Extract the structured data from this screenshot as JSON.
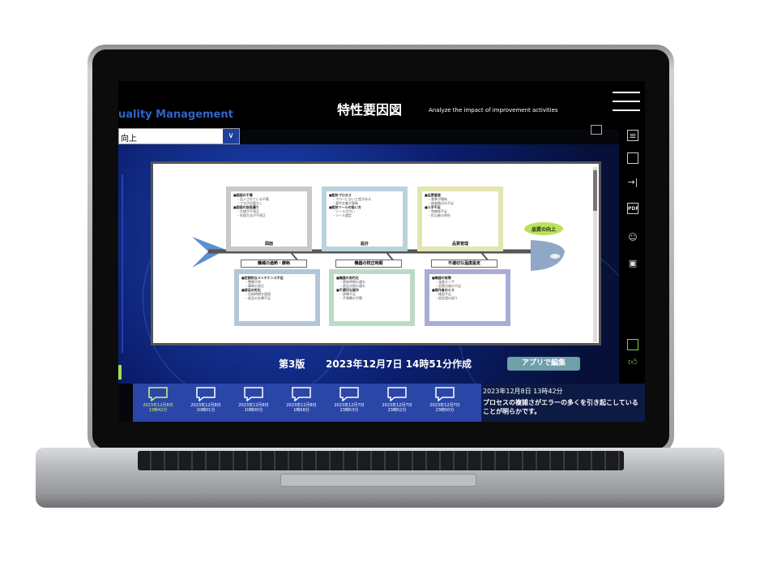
{
  "header": {
    "brand": "uality Management",
    "title": "特性要因図",
    "subtitle": "Analyze the impact of improvement activities"
  },
  "dropdown": {
    "value": "向上",
    "arrow": "∨"
  },
  "diagram": {
    "head_label": "品質の向上",
    "top_boxes": [
      {
        "caption": "図面",
        "color": "#c9c9c9",
        "items": [
          {
            "h": "■図面の不備",
            "s": [
              "・記入されている不備",
              "・寸法が記載なし"
            ]
          },
          {
            "h": "■図面の抜取漏り",
            "s": [
              "・文様が不適正",
              "・処理方法が不適正"
            ]
          }
        ]
      },
      {
        "caption": "設計",
        "color": "#b9d3dd",
        "items": [
          {
            "h": "■設計プロセス",
            "s": [
              "・フローにない工程がある",
              "・要件定義が曖昧"
            ]
          },
          {
            "h": "■設計ツールの扱い方",
            "s": [
              "・ツールが古い",
              "・ツール選定"
            ]
          }
        ]
      },
      {
        "caption": "品質管理",
        "color": "#e3e5b1",
        "items": [
          {
            "h": "■品質管理",
            "s": [
              "・基準が曖昧",
              "・検査観点の不足"
            ]
          },
          {
            "h": "■人手不足",
            "s": [
              "・熟練度不足",
              "・担当者の負担"
            ]
          }
        ]
      }
    ],
    "bottom_boxes": [
      {
        "caption": "機械の過熱・摩耗",
        "color": "#b3c7d9",
        "items": [
          {
            "h": "■定期的なメンテナンス不足",
            "s": [
              "・整備不良",
              "・摩耗の発生"
            ]
          },
          {
            "h": "■部品の劣化",
            "s": [
              "・交換時期を超過",
              "・部品の在庫不足"
            ]
          }
        ]
      },
      {
        "caption": "機器の校正時期",
        "color": "#bddbc4",
        "items": [
          {
            "h": "■機器の老朽化",
            "s": [
              "・更新時期の遅れ",
              "・部品交換の遅れ"
            ]
          },
          {
            "h": "■不適切な操作",
            "s": [
              "・訓練不足",
              "・手順書の不備"
            ]
          }
        ]
      },
      {
        "caption": "不適切な温度設定",
        "color": "#a8add6",
        "items": [
          {
            "h": "■機器の故障",
            "s": [
              "・温度センサ",
              "・定期点検の不足"
            ]
          },
          {
            "h": "■操作者のミス",
            "s": [
              "・確認不足",
              "・設定値の誤り"
            ]
          }
        ]
      }
    ]
  },
  "edition": {
    "version": "第3版",
    "created": "2023年12月7日 14時51分作成",
    "edit_button": "アプリで編集"
  },
  "timeline": [
    {
      "date": "2023年12月8日",
      "time": "13時42分",
      "selected": true
    },
    {
      "date": "2023年12月8日",
      "time": "10時01分",
      "selected": false
    },
    {
      "date": "2023年12月8日",
      "time": "10時00分",
      "selected": false
    },
    {
      "date": "2023年12月8日",
      "time": "1時58分",
      "selected": false
    },
    {
      "date": "2023年12月7日",
      "time": "23時53分",
      "selected": false
    },
    {
      "date": "2023年12月7日",
      "time": "23時52分",
      "selected": false
    },
    {
      "date": "2023年12月7日",
      "time": "23時50分",
      "selected": false
    }
  ],
  "comment": {
    "timestamp": "2023年12月8日 13時42分",
    "text": "プロセスの複雑さがエラーの多くを引き起こしていることが明らかです。"
  },
  "icons": {
    "right": [
      "document-icon",
      "copy-icon",
      "arrow-right-bar-icon",
      "pdf-icon",
      "user-icon",
      "lock-icon"
    ],
    "pdf_label": "PDF",
    "right_bottom": [
      "comment-icon",
      "thumbs-up-icon"
    ]
  },
  "colors": {
    "accent": "#2f64c8",
    "timeline_bg": "#2a47a8",
    "selected": "#d6f07a",
    "like": "#7ed444"
  }
}
